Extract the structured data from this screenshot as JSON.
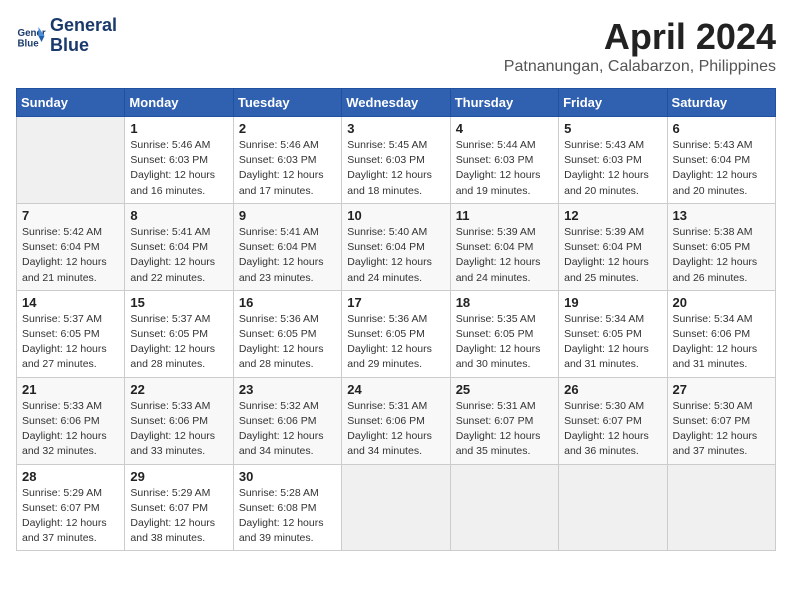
{
  "header": {
    "logo_line1": "General",
    "logo_line2": "Blue",
    "title": "April 2024",
    "subtitle": "Patnanungan, Calabarzon, Philippines"
  },
  "weekdays": [
    "Sunday",
    "Monday",
    "Tuesday",
    "Wednesday",
    "Thursday",
    "Friday",
    "Saturday"
  ],
  "weeks": [
    [
      {
        "day": "",
        "sunrise": "",
        "sunset": "",
        "daylight": ""
      },
      {
        "day": "1",
        "sunrise": "Sunrise: 5:46 AM",
        "sunset": "Sunset: 6:03 PM",
        "daylight": "Daylight: 12 hours and 16 minutes."
      },
      {
        "day": "2",
        "sunrise": "Sunrise: 5:46 AM",
        "sunset": "Sunset: 6:03 PM",
        "daylight": "Daylight: 12 hours and 17 minutes."
      },
      {
        "day": "3",
        "sunrise": "Sunrise: 5:45 AM",
        "sunset": "Sunset: 6:03 PM",
        "daylight": "Daylight: 12 hours and 18 minutes."
      },
      {
        "day": "4",
        "sunrise": "Sunrise: 5:44 AM",
        "sunset": "Sunset: 6:03 PM",
        "daylight": "Daylight: 12 hours and 19 minutes."
      },
      {
        "day": "5",
        "sunrise": "Sunrise: 5:43 AM",
        "sunset": "Sunset: 6:03 PM",
        "daylight": "Daylight: 12 hours and 20 minutes."
      },
      {
        "day": "6",
        "sunrise": "Sunrise: 5:43 AM",
        "sunset": "Sunset: 6:04 PM",
        "daylight": "Daylight: 12 hours and 20 minutes."
      }
    ],
    [
      {
        "day": "7",
        "sunrise": "Sunrise: 5:42 AM",
        "sunset": "Sunset: 6:04 PM",
        "daylight": "Daylight: 12 hours and 21 minutes."
      },
      {
        "day": "8",
        "sunrise": "Sunrise: 5:41 AM",
        "sunset": "Sunset: 6:04 PM",
        "daylight": "Daylight: 12 hours and 22 minutes."
      },
      {
        "day": "9",
        "sunrise": "Sunrise: 5:41 AM",
        "sunset": "Sunset: 6:04 PM",
        "daylight": "Daylight: 12 hours and 23 minutes."
      },
      {
        "day": "10",
        "sunrise": "Sunrise: 5:40 AM",
        "sunset": "Sunset: 6:04 PM",
        "daylight": "Daylight: 12 hours and 24 minutes."
      },
      {
        "day": "11",
        "sunrise": "Sunrise: 5:39 AM",
        "sunset": "Sunset: 6:04 PM",
        "daylight": "Daylight: 12 hours and 24 minutes."
      },
      {
        "day": "12",
        "sunrise": "Sunrise: 5:39 AM",
        "sunset": "Sunset: 6:04 PM",
        "daylight": "Daylight: 12 hours and 25 minutes."
      },
      {
        "day": "13",
        "sunrise": "Sunrise: 5:38 AM",
        "sunset": "Sunset: 6:05 PM",
        "daylight": "Daylight: 12 hours and 26 minutes."
      }
    ],
    [
      {
        "day": "14",
        "sunrise": "Sunrise: 5:37 AM",
        "sunset": "Sunset: 6:05 PM",
        "daylight": "Daylight: 12 hours and 27 minutes."
      },
      {
        "day": "15",
        "sunrise": "Sunrise: 5:37 AM",
        "sunset": "Sunset: 6:05 PM",
        "daylight": "Daylight: 12 hours and 28 minutes."
      },
      {
        "day": "16",
        "sunrise": "Sunrise: 5:36 AM",
        "sunset": "Sunset: 6:05 PM",
        "daylight": "Daylight: 12 hours and 28 minutes."
      },
      {
        "day": "17",
        "sunrise": "Sunrise: 5:36 AM",
        "sunset": "Sunset: 6:05 PM",
        "daylight": "Daylight: 12 hours and 29 minutes."
      },
      {
        "day": "18",
        "sunrise": "Sunrise: 5:35 AM",
        "sunset": "Sunset: 6:05 PM",
        "daylight": "Daylight: 12 hours and 30 minutes."
      },
      {
        "day": "19",
        "sunrise": "Sunrise: 5:34 AM",
        "sunset": "Sunset: 6:05 PM",
        "daylight": "Daylight: 12 hours and 31 minutes."
      },
      {
        "day": "20",
        "sunrise": "Sunrise: 5:34 AM",
        "sunset": "Sunset: 6:06 PM",
        "daylight": "Daylight: 12 hours and 31 minutes."
      }
    ],
    [
      {
        "day": "21",
        "sunrise": "Sunrise: 5:33 AM",
        "sunset": "Sunset: 6:06 PM",
        "daylight": "Daylight: 12 hours and 32 minutes."
      },
      {
        "day": "22",
        "sunrise": "Sunrise: 5:33 AM",
        "sunset": "Sunset: 6:06 PM",
        "daylight": "Daylight: 12 hours and 33 minutes."
      },
      {
        "day": "23",
        "sunrise": "Sunrise: 5:32 AM",
        "sunset": "Sunset: 6:06 PM",
        "daylight": "Daylight: 12 hours and 34 minutes."
      },
      {
        "day": "24",
        "sunrise": "Sunrise: 5:31 AM",
        "sunset": "Sunset: 6:06 PM",
        "daylight": "Daylight: 12 hours and 34 minutes."
      },
      {
        "day": "25",
        "sunrise": "Sunrise: 5:31 AM",
        "sunset": "Sunset: 6:07 PM",
        "daylight": "Daylight: 12 hours and 35 minutes."
      },
      {
        "day": "26",
        "sunrise": "Sunrise: 5:30 AM",
        "sunset": "Sunset: 6:07 PM",
        "daylight": "Daylight: 12 hours and 36 minutes."
      },
      {
        "day": "27",
        "sunrise": "Sunrise: 5:30 AM",
        "sunset": "Sunset: 6:07 PM",
        "daylight": "Daylight: 12 hours and 37 minutes."
      }
    ],
    [
      {
        "day": "28",
        "sunrise": "Sunrise: 5:29 AM",
        "sunset": "Sunset: 6:07 PM",
        "daylight": "Daylight: 12 hours and 37 minutes."
      },
      {
        "day": "29",
        "sunrise": "Sunrise: 5:29 AM",
        "sunset": "Sunset: 6:07 PM",
        "daylight": "Daylight: 12 hours and 38 minutes."
      },
      {
        "day": "30",
        "sunrise": "Sunrise: 5:28 AM",
        "sunset": "Sunset: 6:08 PM",
        "daylight": "Daylight: 12 hours and 39 minutes."
      },
      {
        "day": "",
        "sunrise": "",
        "sunset": "",
        "daylight": ""
      },
      {
        "day": "",
        "sunrise": "",
        "sunset": "",
        "daylight": ""
      },
      {
        "day": "",
        "sunrise": "",
        "sunset": "",
        "daylight": ""
      },
      {
        "day": "",
        "sunrise": "",
        "sunset": "",
        "daylight": ""
      }
    ]
  ]
}
